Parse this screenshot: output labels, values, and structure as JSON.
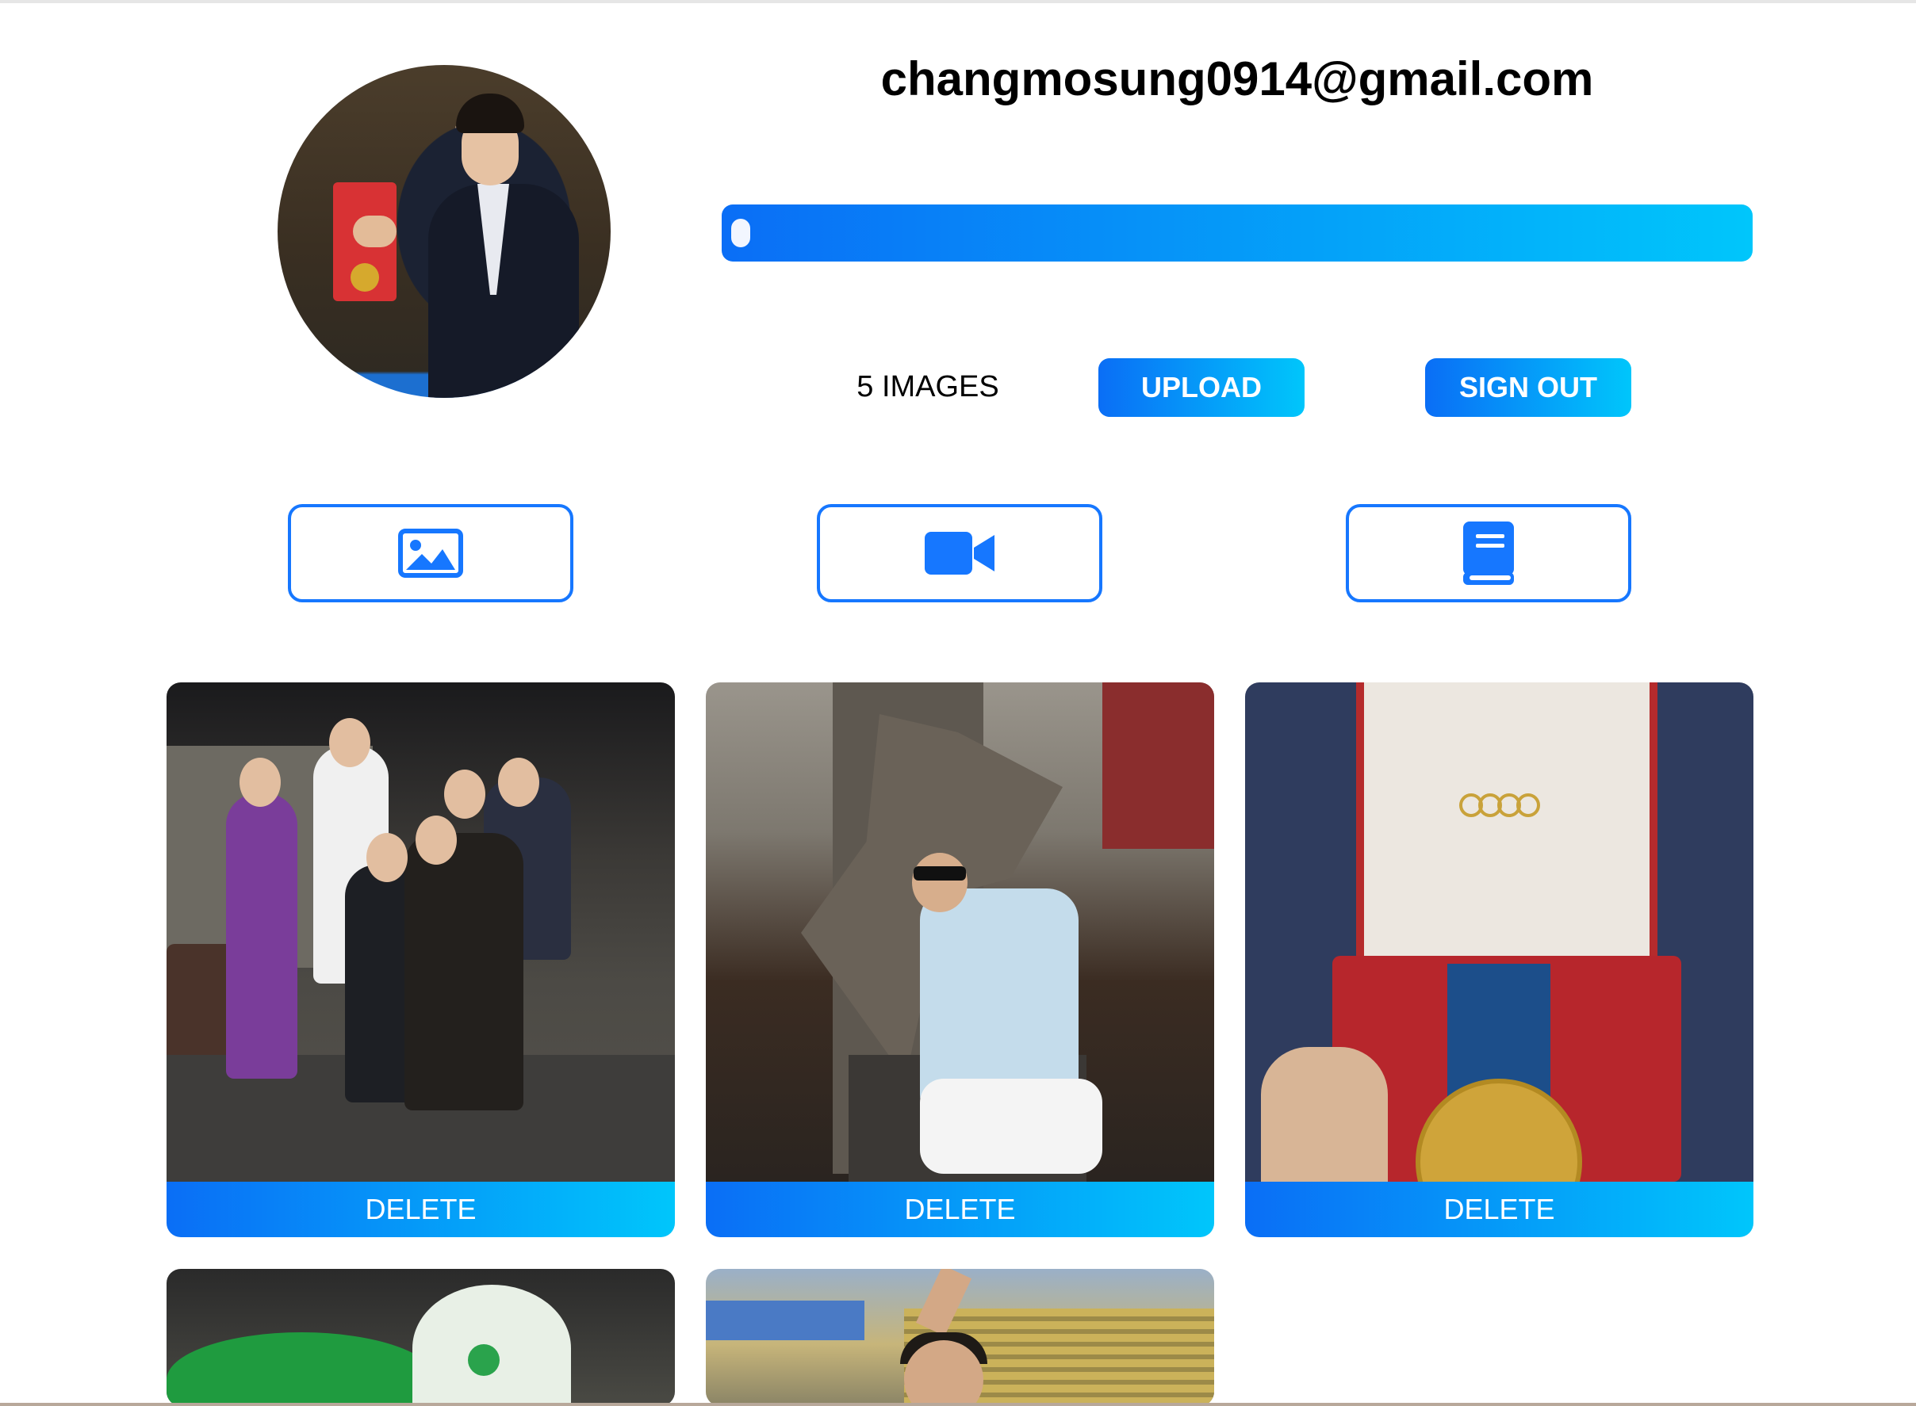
{
  "profile": {
    "email": "changmosung0914@gmail.com",
    "avatar_icon": "user-photo",
    "upload_progress": 0
  },
  "actions": {
    "image_count": "5 IMAGES",
    "upload_label": "UPLOAD",
    "signout_label": "SIGN OUT"
  },
  "tabs": [
    {
      "icon": "image-icon"
    },
    {
      "icon": "video-icon"
    },
    {
      "icon": "book-icon"
    }
  ],
  "gallery": {
    "items": [
      {
        "delete_label": "DELETE"
      },
      {
        "delete_label": "DELETE"
      },
      {
        "delete_label": "DELETE"
      },
      {
        "delete_label": ""
      },
      {
        "delete_label": ""
      }
    ]
  },
  "colors": {
    "accent_start": "#0a6ef6",
    "accent_end": "#00c6fb",
    "tab_border": "#1677ff"
  }
}
